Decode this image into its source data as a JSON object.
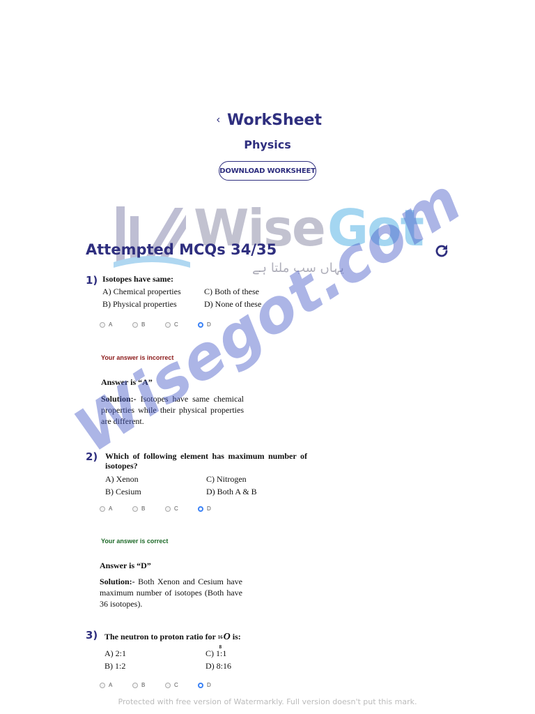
{
  "header": {
    "title": "WorkSheet",
    "subject": "Physics",
    "download_label": "DOWNLOAD WORKSHEET"
  },
  "progress": {
    "label": "Attempted MCQs 34/35"
  },
  "questions": [
    {
      "number": "1)",
      "text": "Isotopes have same:",
      "options": [
        "A) Chemical properties",
        "B) Physical properties",
        "C) Both of these",
        "D) None of these"
      ],
      "radios": [
        "A",
        "B",
        "C",
        "D"
      ],
      "selected": "D",
      "status": "Your answer is incorrect",
      "answer": "Answer is “A”",
      "solution_label": "Solution:-",
      "solution": "Isotopes have same chemical properties while their physical properties are different."
    },
    {
      "number": "2)",
      "text": "Which of following element has maximum number of isotopes?",
      "options": [
        "A) Xenon",
        "B) Cesium",
        "C) Nitrogen",
        "D) Both A & B"
      ],
      "radios": [
        "A",
        "B",
        "C",
        "D"
      ],
      "selected": "D",
      "status": "Your answer is correct",
      "answer": "Answer is “D”",
      "solution_label": "Solution:-",
      "solution": "Both Xenon and Cesium have maximum number of isotopes (Both have 36 isotopes)."
    },
    {
      "number": "3)",
      "text": "The neutron to proton ratio for",
      "text_sup": "16",
      "text_sub": "8",
      "text_el": "O",
      "text_end": " is:",
      "options": [
        "A) 2:1",
        "B) 1:2",
        "C) 1:1",
        "D) 8:16"
      ],
      "radios": [
        "A",
        "B",
        "C",
        "D"
      ],
      "selected": "D"
    }
  ],
  "watermark": {
    "brand_part1": "Wise",
    "brand_part2": "Got",
    "tagline": "یہاں سب ملتا ہے",
    "diagonal": "Wisegot.com",
    "footer": "Protected with free version of Watermarkly. Full version doesn't put this mark."
  },
  "colors": {
    "brand": "#2f2f7f",
    "incorrect": "#8b1a1a",
    "correct": "#1f6b2a",
    "radio_selected": "#3b82f6"
  },
  "icons": {
    "back": "chevron-left-icon",
    "refresh": "refresh-icon"
  }
}
